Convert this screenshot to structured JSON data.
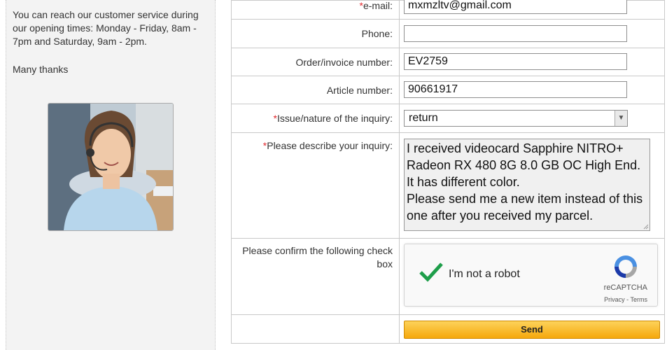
{
  "sidebar": {
    "service_text": "You can reach our customer service during our opening times: Monday - Friday, 8am - 7pm and Saturday, 9am - 2pm.",
    "thanks_text": "Many thanks"
  },
  "form": {
    "required_mark": "*",
    "email": {
      "label": "e-mail:",
      "value": "mxmzltv@gmail.com"
    },
    "phone": {
      "label": "Phone:",
      "value": ""
    },
    "order_number": {
      "label": "Order/invoice number:",
      "value": "EV2759"
    },
    "article_number": {
      "label": "Article number:",
      "value": "90661917"
    },
    "issue": {
      "label": "Issue/nature of the inquiry:",
      "selected": "return",
      "icon": "chevron-down-icon"
    },
    "inquiry": {
      "label": "Please describe your inquiry:",
      "value": "I received videocard Sapphire NITRO+ Radeon RX 480 8G 8.0 GB OC High End. It has different color.\nPlease send me a new item instead of this one after you received my parcel."
    },
    "confirm": {
      "label": "Please confirm the following check box",
      "captcha_label": "I'm not a robot",
      "captcha_brand": "reCAPTCHA",
      "captcha_links": "Privacy - Terms",
      "checked": true
    },
    "send_label": "Send"
  },
  "colors": {
    "required": "#e0282d",
    "check": "#1e9e4a",
    "send_top": "#fdd25a",
    "send_bottom": "#f5a80c"
  }
}
